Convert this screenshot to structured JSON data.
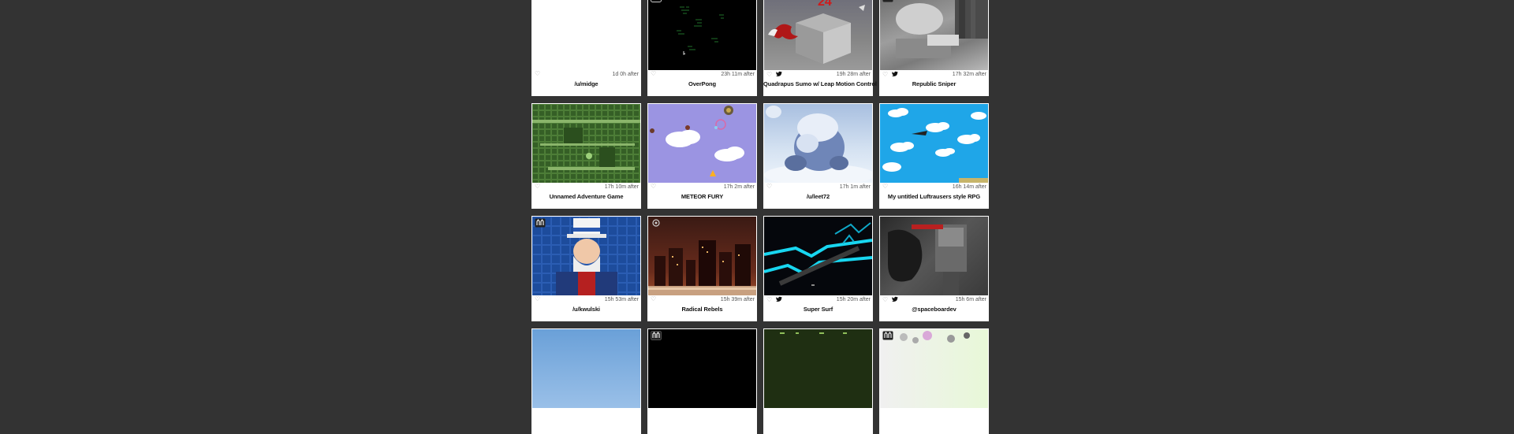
{
  "cards": [
    {
      "time": "1d 0h after",
      "title": "/u/midge",
      "twitter": false,
      "badge": ""
    },
    {
      "time": "23h 11m after",
      "title": "OverPong",
      "twitter": false,
      "badge": "play-icon"
    },
    {
      "time": "19h 28m after",
      "title": "Quadrapus Sumo w/ Leap Motion Control",
      "twitter": true,
      "badge": ""
    },
    {
      "time": "17h 32m after",
      "title": "Republic Sniper",
      "twitter": true,
      "badge": "binoculars-icon"
    },
    {
      "time": "17h 10m after",
      "title": "Unnamed Adventure Game",
      "twitter": false,
      "badge": ""
    },
    {
      "time": "17h 2m after",
      "title": "METEOR FURY",
      "twitter": false,
      "badge": ""
    },
    {
      "time": "17h 1m after",
      "title": "/u/leet72",
      "twitter": false,
      "badge": ""
    },
    {
      "time": "16h 14m after",
      "title": "My untitled Luftrausers style RPG",
      "twitter": false,
      "badge": ""
    },
    {
      "time": "15h 53m after",
      "title": "/u/kwulski",
      "twitter": false,
      "badge": "binoculars-icon"
    },
    {
      "time": "15h 39m after",
      "title": "Radical Rebels",
      "twitter": false,
      "badge": ""
    },
    {
      "time": "15h 20m after",
      "title": "Super Surf",
      "twitter": true,
      "badge": ""
    },
    {
      "time": "15h 6m after",
      "title": "@spaceboardev",
      "twitter": true,
      "badge": ""
    },
    {
      "time": "",
      "title": "",
      "twitter": false,
      "badge": ""
    },
    {
      "time": "",
      "title": "",
      "twitter": false,
      "badge": "binoculars-icon"
    },
    {
      "time": "",
      "title": "",
      "twitter": false,
      "badge": ""
    },
    {
      "time": "",
      "title": "",
      "twitter": false,
      "badge": "binoculars-icon"
    }
  ],
  "thumb_texts": {
    "quadrapus_score": "24"
  },
  "colors": {
    "page_bg": "#333333",
    "card_bg": "#ffffff",
    "twitter": "#1da1f2"
  }
}
